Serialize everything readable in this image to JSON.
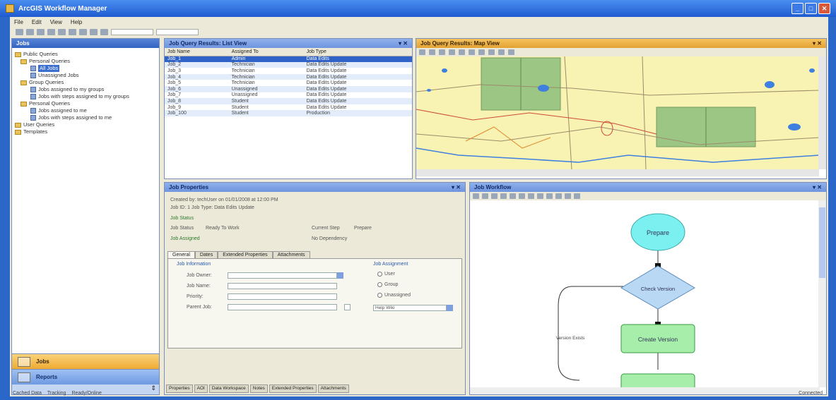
{
  "window": {
    "title": "ArcGIS Workflow Manager"
  },
  "menu": [
    "File",
    "Edit",
    "View",
    "Help"
  ],
  "left_panel": {
    "title": "Jobs",
    "tree": [
      {
        "label": "Public Queries",
        "kind": "folder",
        "level": 0
      },
      {
        "label": "Personal Queries",
        "kind": "folder",
        "level": 1
      },
      {
        "label": "All Jobs",
        "kind": "query",
        "level": 2,
        "selected": true
      },
      {
        "label": "Unassigned Jobs",
        "kind": "query",
        "level": 2
      },
      {
        "label": "Group Queries",
        "kind": "folder",
        "level": 1
      },
      {
        "label": "Jobs assigned to my groups",
        "kind": "query",
        "level": 2
      },
      {
        "label": "Jobs with steps assigned to my groups",
        "kind": "query",
        "level": 2
      },
      {
        "label": "Personal Queries",
        "kind": "folder",
        "level": 1
      },
      {
        "label": "Jobs assigned to me",
        "kind": "query",
        "level": 2
      },
      {
        "label": "Jobs with steps assigned to me",
        "kind": "query",
        "level": 2
      },
      {
        "label": "User Queries",
        "kind": "folder",
        "level": 0
      },
      {
        "label": "Templates",
        "kind": "folder",
        "level": 0
      }
    ],
    "nav": {
      "jobs": "Jobs",
      "reports": "Reports"
    }
  },
  "grid": {
    "title": "Job Query Results: List View",
    "columns": [
      "Job Name",
      "Assigned To",
      "Job Type"
    ],
    "rows": [
      [
        "Job_1",
        "Admin",
        "Data Edits"
      ],
      [
        "Job_2",
        "Technician",
        "Data Edits Update"
      ],
      [
        "Job_3",
        "Technician",
        "Data Edits Update"
      ],
      [
        "Job_4",
        "Technician",
        "Data Edits Update"
      ],
      [
        "Job_5",
        "Technician",
        "Data Edits Update"
      ],
      [
        "Job_6",
        "Unassigned",
        "Data Edits Update"
      ],
      [
        "Job_7",
        "Unassigned",
        "Data Edits Update"
      ],
      [
        "Job_8",
        "Student",
        "Data Edits Update"
      ],
      [
        "Job_9",
        "Student",
        "Data Edits Update"
      ],
      [
        "Job_100",
        "Student",
        "Production"
      ]
    ]
  },
  "map": {
    "title": "Job Query Results: Map View"
  },
  "properties": {
    "title": "Job Properties",
    "created_line": "Created by: techUser on 01/01/2008 at 12:00 PM",
    "job_line": "Job ID: 1    Job Type: Data Edits Update",
    "section_title": "Job Status",
    "status_label": "Job Status",
    "status_value": "Ready To Work",
    "current_step_label": "Current Step",
    "current_step_value": "Prepare",
    "job_assigned_label": "Job Assigned",
    "job_dependency": "No Dependency",
    "tabs": [
      "General",
      "Dates",
      "Extended Properties",
      "Attachments"
    ],
    "group_info": "Job Information",
    "job_owner_label": "Job Owner:",
    "job_name_label": "Job Name:",
    "priority_label": "Priority:",
    "parent_label": "Parent Job:",
    "assign_group": "Job Assignment",
    "radio_user": "User",
    "radio_group": "Group",
    "radio_unassigned": "Unassigned",
    "assign_value": "Help Wiki"
  },
  "bottom_tabs": [
    "Properties",
    "AOI",
    "Data Workspace",
    "Notes",
    "Extended Properties",
    "Attachments"
  ],
  "workflow": {
    "title": "Job Workflow",
    "nodes": {
      "start": "Prepare",
      "decision": "Check Version",
      "step": "Create Version",
      "edge_label": "Version Exists"
    }
  },
  "status": {
    "left": [
      "Cached Data",
      "Tracking",
      "Ready/Online"
    ],
    "right": "Connected"
  },
  "colors": {
    "title_blue": "#1f5bd0",
    "panel_orange": "#e3a234",
    "workflow_start": "#7af0f0",
    "workflow_decision": "#b8d8f4",
    "workflow_step": "#a6eeaa",
    "aoi_green": "#8dbf7c"
  }
}
